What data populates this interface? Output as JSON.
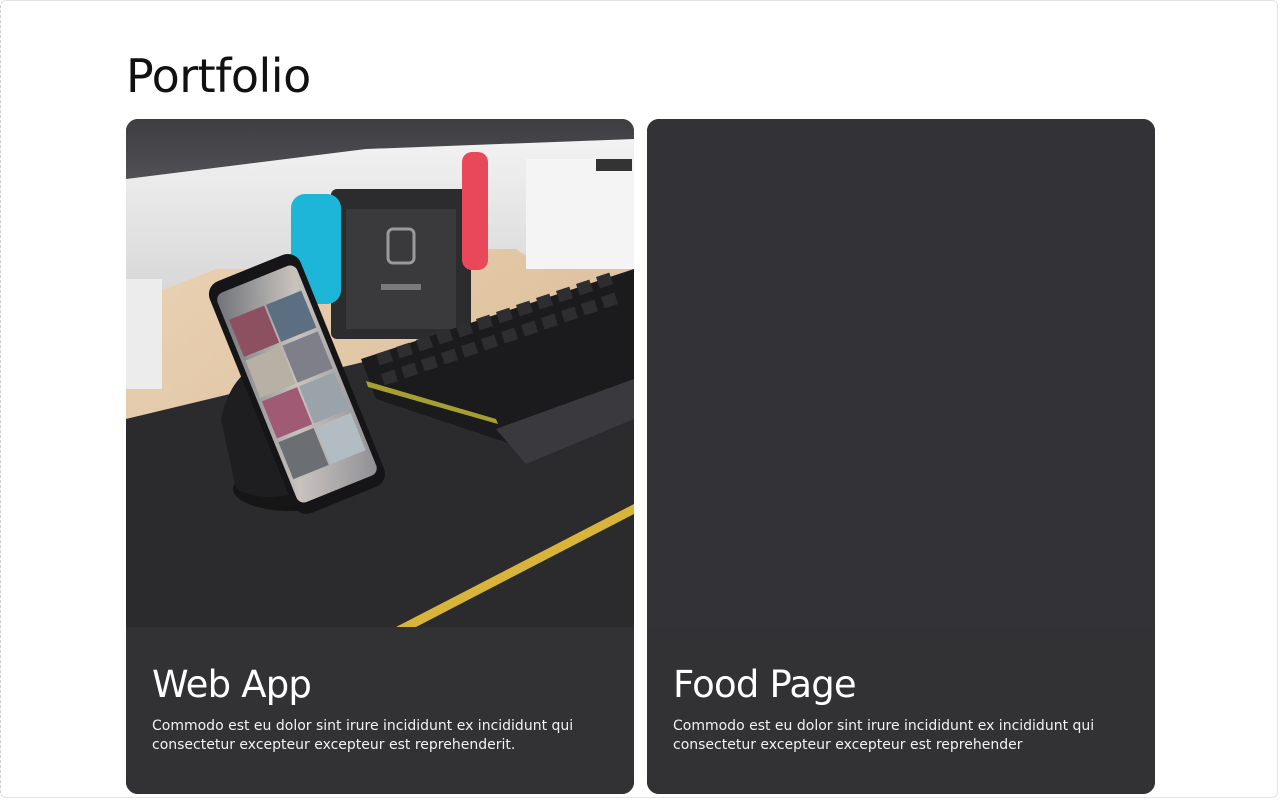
{
  "page": {
    "title": "Portfolio"
  },
  "cards": [
    {
      "title": "Web App",
      "description": "Commodo est eu dolor sint irure incididunt ex incididunt qui consectetur excepteur excepteur est reprehenderit.",
      "image": "desk-setup-photo"
    },
    {
      "title": "Food Page",
      "description": "Commodo est eu dolor sint irure incididunt ex incididunt qui consectetur excepteur excepteur est reprehender",
      "image": "empty-dark-placeholder"
    }
  ],
  "colors": {
    "card_background": "#323234",
    "text_primary": "#111111",
    "text_on_dark": "#ffffff"
  }
}
